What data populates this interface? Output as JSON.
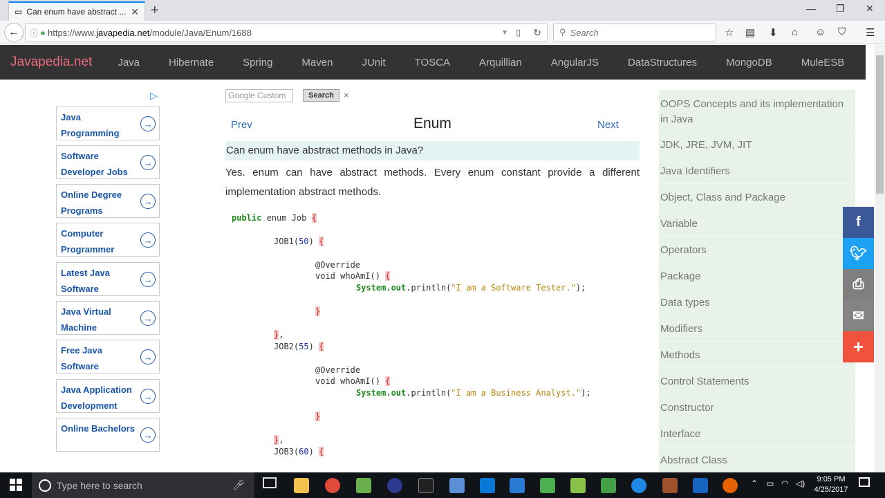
{
  "browser": {
    "tab_title": "Can enum have abstract ...",
    "tab_close": "✕",
    "new_tab": "+",
    "url_prefix": "https://www.",
    "url_domain": "javapedia.net",
    "url_path": "/module/Java/Enum/1688",
    "search_placeholder": "Search"
  },
  "site": {
    "logo": "Javapedia.net",
    "nav": [
      "Java",
      "Hibernate",
      "Spring",
      "Maven",
      "JUnit",
      "TOSCA",
      "Arquillian",
      "AngularJS",
      "DataStructures",
      "MongoDB",
      "MuleESB"
    ]
  },
  "ads": [
    {
      "label": "Java Programming"
    },
    {
      "label": "Software Developer Jobs"
    },
    {
      "label": "Online Degree Programs"
    },
    {
      "label": "Computer Programmer"
    },
    {
      "label": "Latest Java Software"
    },
    {
      "label": "Java Virtual Machine"
    },
    {
      "label": "Free Java Software"
    },
    {
      "label": "Java Application Development"
    },
    {
      "label": "Online Bachelors"
    }
  ],
  "main": {
    "search_placeholder": "Google Custom",
    "search_button": "Search",
    "clear": "×",
    "prev": "Prev",
    "next": "Next",
    "title": "Enum",
    "question": "Can enum have abstract methods in Java?",
    "answer": "Yes. enum can have abstract methods. Every enum constant provide a different implementation abstract methods."
  },
  "code": {
    "l1_kw": "public",
    "l1_rest": " enum Job ",
    "job1": "JOB1(",
    "job1_num": "50",
    "job2": "JOB2(",
    "job2_num": "55",
    "job3": "JOB3(",
    "job3_num": "60",
    "override": "@Override",
    "method": "void whoAmI() ",
    "sys": "System.",
    "out": "out",
    "println": ".println(",
    "str1": "\"I am a Software Tester.\"",
    "str2": "\"I am a Business Analyst.\"",
    "close_paren": ");",
    "open_brace": "{",
    "close_brace": "}",
    "comma": ","
  },
  "sidebar": [
    "OOPS Concepts and its implementation in Java",
    "JDK, JRE, JVM, JIT",
    "Java Identifiers",
    "Object, Class and Package",
    "Variable",
    "Operators",
    "Package",
    "Data types",
    "Modifiers",
    "Methods",
    "Control Statements",
    "Constructor",
    "Interface",
    "Abstract Class"
  ],
  "taskbar": {
    "search_placeholder": "Type here to search",
    "time": "9:05 PM",
    "date": "4/25/2017"
  },
  "colors": {
    "facebook": "#3b5998",
    "twitter": "#1da1f2",
    "print": "#7f7f7f",
    "email": "#848484",
    "more": "#f0523d"
  }
}
